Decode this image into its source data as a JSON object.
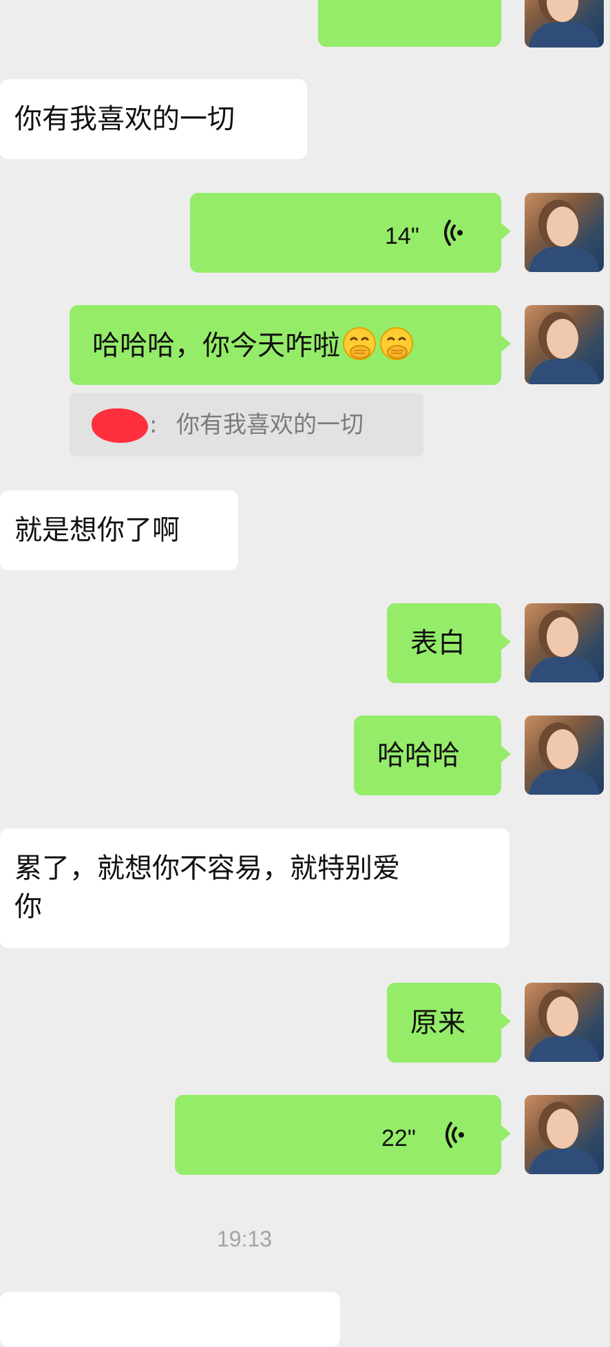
{
  "messages": {
    "m0_partial": "",
    "m1_text": "你有我喜欢的一切",
    "m2_voice_duration": "14\"",
    "m3_text": "哈哈哈，你今天咋啦",
    "m3_emojis": [
      "hand-over-mouth-emoji",
      "hand-over-mouth-emoji"
    ],
    "m3_quote": "你有我喜欢的一切",
    "m4_text": "就是想你了啊",
    "m5_text": "表白",
    "m6_text": "哈哈哈",
    "m7_text_line1": "累了，就想你不容易，就特别爱",
    "m7_text_line2": "你",
    "m8_text": "原来",
    "m9_voice_duration": "22\""
  },
  "timestamp": "19:13",
  "colors": {
    "background": "#ededed",
    "my_bubble": "#95ec69",
    "their_bubble": "#ffffff",
    "quote_bg": "#e2e2e2",
    "redaction": "#ff2f3d"
  },
  "icons": {
    "voice": "voice-wave-icon",
    "avatar": "user-avatar"
  }
}
